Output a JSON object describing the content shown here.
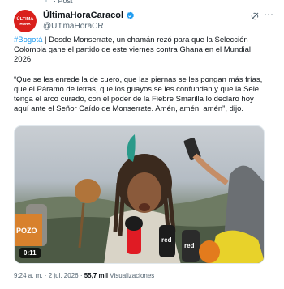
{
  "account": {
    "avatar_line1": "ÚLTIMA",
    "avatar_line2": "HORA",
    "display_name": "ÚltimaHoraCaracol",
    "handle": "@UltimaHoraCR",
    "verified_color": "#1d9bf0"
  },
  "icons": {
    "grok": "grok-icon",
    "more": "more-icon",
    "verified": "verified-badge-icon"
  },
  "tweet": {
    "hashtag": "#Bogotá",
    "paragraph1_rest": " | Desde Monserrate, un chamán rezó para que la Selección Colombia gane el partido de este viernes contra Ghana en el Mundial 2026.",
    "paragraph2": "“Que se les enrede la de cuero, que las piernas se les pongan más frías, que el Páramo de letras, que los guayos se les confundan y que la Sele tenga el arco curado, con el poder de la Fiebre Smarilla lo declaro hoy aquí ante el Señor Caído de Monserrate. Amén, amén, amén”, dijo."
  },
  "video": {
    "duration": "0:11",
    "overlay_text": "POZO",
    "mic_labels": [
      "red",
      "red"
    ]
  },
  "meta": {
    "time": "9:24 a. m.",
    "separator1": " · ",
    "date": "2 jul. 2026",
    "separator2": " · ",
    "views_count": "55,7 mil",
    "views_label": " Visualizaciones"
  }
}
